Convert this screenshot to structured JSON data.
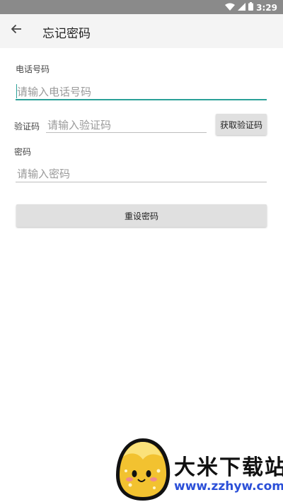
{
  "status_bar": {
    "time": "3:29",
    "icons": [
      "wifi-icon",
      "cell-signal-icon",
      "battery-icon"
    ]
  },
  "app_bar": {
    "title": "忘记密码",
    "back_icon": "back-arrow-icon"
  },
  "form": {
    "phone_label": "电话号码",
    "phone_placeholder": "请输入电话号码",
    "code_label": "验证码",
    "code_placeholder": "请输入验证码",
    "get_code_button": "获取验证码",
    "password_label": "密码",
    "password_placeholder": "请输入密码",
    "reset_button": "重设密码"
  },
  "watermark": {
    "name": "大米下载站",
    "url": "www.zzhyw.com"
  },
  "colors": {
    "accent": "#2aa198",
    "app_bar_bg": "#f4f4f4",
    "status_bar_bg": "#8a8a8a",
    "button_bg": "#e0e0e0",
    "watermark_url": "#2b4fd8"
  }
}
